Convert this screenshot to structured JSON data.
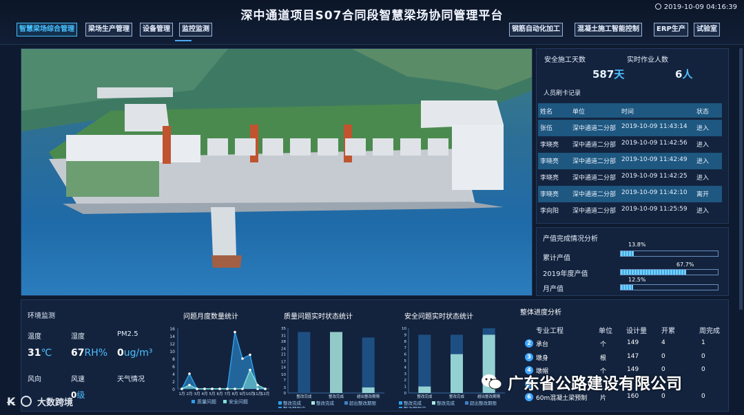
{
  "header": {
    "title": "深中通道项目S07合同段智慧梁场协同管理平台",
    "clock": "2019-10-09 04:16:39"
  },
  "nav_left": [
    "智慧梁场综合管理",
    "梁场生产管理",
    "设备管理",
    "监控监测"
  ],
  "nav_right": [
    "钢筋自动化加工",
    "混凝土施工智能控制",
    "ERP生产",
    "试验室"
  ],
  "stats": {
    "safe_days_label": "安全施工天数",
    "safe_days_value": "587",
    "safe_days_unit": "天",
    "workers_label": "实时作业人数",
    "workers_value": "6",
    "workers_unit": "人",
    "card_label": "人员刷卡记录"
  },
  "card_table": {
    "headers": [
      "姓名",
      "单位",
      "时间",
      "状态"
    ],
    "rows": [
      [
        "张伍",
        "深中通道二分部",
        "2019-10-09 11:43:14",
        "进入"
      ],
      [
        "李晓亮",
        "深中通道二分部",
        "2019-10-09 11:42:56",
        "进入"
      ],
      [
        "李晓亮",
        "深中通道二分部",
        "2019-10-09 11:42:49",
        "进入"
      ],
      [
        "李晓亮",
        "深中通道二分部",
        "2019-10-09 11:42:25",
        "进入"
      ],
      [
        "李晓亮",
        "深中通道二分部",
        "2019-10-09 11:42:10",
        "离开"
      ],
      [
        "李向阳",
        "深中通道二分部",
        "2019-10-09 11:25:59",
        "进入"
      ]
    ]
  },
  "output": {
    "title": "产值完成情况分析",
    "items": [
      {
        "label": "累计产值",
        "pct_text": "13.8%",
        "pct": 0.138
      },
      {
        "label": "2019年度产值",
        "pct_text": "67.7%",
        "pct": 0.677
      },
      {
        "label": "月产值",
        "pct_text": "12.5%",
        "pct": 0.125
      }
    ]
  },
  "env": {
    "title": "环境监测",
    "temp_label": "温度",
    "temp_value": "31",
    "temp_unit": "℃",
    "hum_label": "湿度",
    "hum_value": "67",
    "hum_unit": "RH%",
    "pm_label": "PM2.5",
    "pm_value": "0",
    "pm_unit": "ug/m³",
    "wind_dir_label": "风向",
    "wind_speed_label": "风速",
    "weather_label": "天气情况",
    "wind_speed_value": "0",
    "wind_speed_unit": "级"
  },
  "chart_data": [
    {
      "type": "area",
      "title": "问题月度数量统计",
      "categories": [
        "1月",
        "2月",
        "3月",
        "4月",
        "5月",
        "6月",
        "7月",
        "8月",
        "9月",
        "10月",
        "11月",
        "12月"
      ],
      "ylim": [
        0,
        16
      ],
      "yticks": [
        0,
        2,
        4,
        6,
        8,
        10,
        12,
        14,
        16
      ],
      "series": [
        {
          "name": "质量问题",
          "values": [
            0,
            4,
            0,
            0,
            0,
            0,
            0,
            15,
            8,
            9,
            0,
            0
          ]
        },
        {
          "name": "安全问题",
          "values": [
            0,
            1,
            0,
            0,
            0,
            0,
            0,
            0,
            0,
            5,
            1,
            0
          ]
        }
      ]
    },
    {
      "type": "bar",
      "title": "质量问题实时状态统计",
      "categories": [
        "整改完成",
        "整改完成",
        "超出整改期限"
      ],
      "ylim": [
        0,
        35
      ],
      "yticks": [
        0,
        3,
        7,
        10,
        14,
        17,
        21,
        24,
        28,
        31,
        35
      ],
      "series": [
        {
          "name": "整改完成",
          "values": [
            0,
            33,
            3
          ]
        },
        {
          "name": "整改期限内",
          "values": [
            33,
            0,
            30
          ]
        }
      ],
      "legend": [
        "整改完成",
        "整改完成",
        "超出整改期限",
        "整改期限内"
      ]
    },
    {
      "type": "bar",
      "title": "安全问题实时状态统计",
      "categories": [
        "整改完成",
        "整改完成",
        "超出整改期限"
      ],
      "ylim": [
        0,
        10
      ],
      "yticks": [
        0,
        1,
        2,
        3,
        4,
        5,
        6,
        7,
        8,
        9,
        10
      ],
      "series": [
        {
          "name": "整改完成",
          "values": [
            1,
            6,
            9
          ]
        },
        {
          "name": "整改期限内",
          "values": [
            9,
            9,
            10
          ]
        }
      ],
      "legend": [
        "整改完成",
        "整改完成",
        "超出整改期限",
        "整改期限内"
      ]
    }
  ],
  "progress": {
    "title": "整体进度分析",
    "headers": [
      "专业工程",
      "单位",
      "设计量",
      "开累",
      "周完成"
    ],
    "rows": [
      {
        "no": "2",
        "name": "承台",
        "unit": "个",
        "design": "149",
        "acc": "4",
        "week": "1"
      },
      {
        "no": "3",
        "name": "墩身",
        "unit": "根",
        "design": "147",
        "acc": "0",
        "week": "0"
      },
      {
        "no": "4",
        "name": "墩帽",
        "unit": "个",
        "design": "149",
        "acc": "0",
        "week": "0"
      },
      {
        "no": "5",
        "name": "",
        "unit": "",
        "design": "",
        "acc": "",
        "week": ""
      },
      {
        "no": "6",
        "name": "60m混凝土梁预制",
        "unit": "片",
        "design": "160",
        "acc": "0",
        "week": "0"
      }
    ]
  },
  "watermark": {
    "company": "广东省公路建设有限公司",
    "logo_text": "大数跨境"
  },
  "colors": {
    "accent": "#48c3ff",
    "row": "#1e5780",
    "panel": "#13233e"
  }
}
